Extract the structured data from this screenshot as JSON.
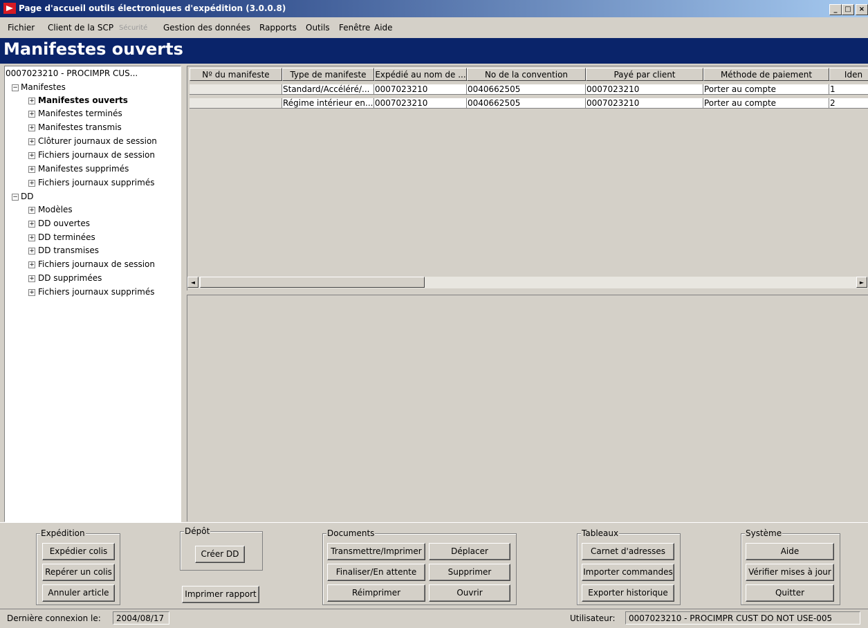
{
  "window": {
    "title": "Page d'accueil outils électroniques d'expédition (3.0.0.8)",
    "controls": [
      "_",
      "□",
      "×"
    ]
  },
  "menu": {
    "items": [
      "Fichier",
      "Client de la SCP",
      "Sécurité",
      "Gestion des données",
      "Rapports",
      "Outils",
      "Fenêtre",
      "Aide"
    ]
  },
  "header": {
    "title": "Manifestes ouverts"
  },
  "tree": {
    "root": "0007023210 - PROCIMPR CUS...",
    "groups": [
      {
        "label": "Manifestes",
        "toggle": "−",
        "items": [
          "Manifestes ouverts",
          "Manifestes terminés",
          "Manifestes transmis",
          "Clôturer journaux de session",
          "Fichiers journaux de session",
          "Manifestes supprimés",
          "Fichiers journaux supprimés"
        ]
      },
      {
        "label": "DD",
        "toggle": "−",
        "items": [
          "Modèles",
          "DD ouvertes",
          "DD terminées",
          "DD transmises",
          "Fichiers journaux de session",
          "DD supprimées",
          "Fichiers journaux supprimés"
        ]
      }
    ],
    "item_toggle": "+",
    "selected": "Manifestes ouverts"
  },
  "grid": {
    "columns": [
      "Nº du manifeste",
      "Type de manifeste",
      "Expédié au nom de ...",
      "No de la convention",
      "Payé par client",
      "Méthode de paiement",
      "Iden"
    ],
    "rows": [
      [
        "",
        "Standard/Accéléré/...",
        "0007023210",
        "0040662505",
        "0007023210",
        "Porter au compte",
        "1"
      ],
      [
        "",
        "Régime intérieur en...",
        "0007023210",
        "0040662505",
        "0007023210",
        "Porter au compte",
        "2"
      ]
    ],
    "scroll_left": "◄",
    "scroll_right": "►"
  },
  "groups": {
    "expedition": {
      "label": "Expédition",
      "buttons": [
        "Expédier colis",
        "Repérer un colis",
        "Annuler article"
      ]
    },
    "depot": {
      "label": "Dépôt",
      "buttons": [
        "Créer DD"
      ]
    },
    "print_report": "Imprimer rapport",
    "documents": {
      "label": "Documents",
      "buttons": [
        "Transmettre/Imprimer",
        "Déplacer",
        "Finaliser/En attente",
        "Supprimer",
        "Réimprimer",
        "Ouvrir"
      ]
    },
    "tableaux": {
      "label": "Tableaux",
      "buttons": [
        "Carnet d'adresses",
        "Importer commandes",
        "Exporter historique"
      ]
    },
    "systeme": {
      "label": "Système",
      "buttons": [
        "Aide",
        "Vérifier mises à jour",
        "Quitter"
      ]
    }
  },
  "status": {
    "last_login_label": "Dernière connexion le:",
    "last_login_value": "2004/08/17",
    "user_label": "Utilisateur:",
    "user_value": "0007023210 - PROCIMPR CUST DO NOT USE-005"
  }
}
